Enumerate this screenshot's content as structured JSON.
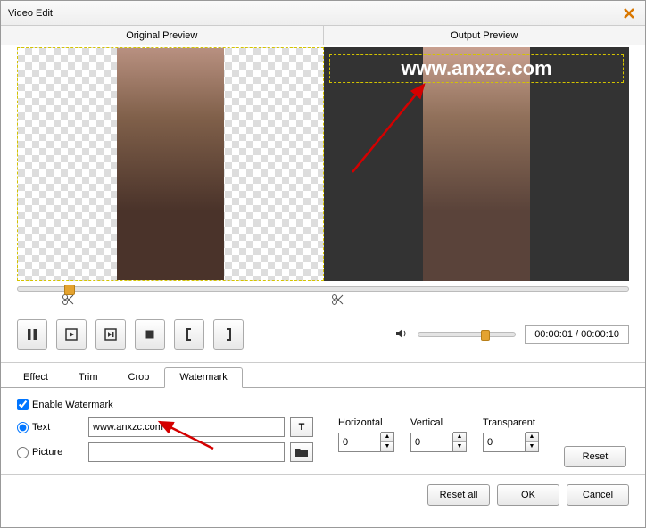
{
  "window": {
    "title": "Video Edit"
  },
  "previews": {
    "original_label": "Original Preview",
    "output_label": "Output Preview",
    "watermark_text": "www.anxzc.com"
  },
  "playback": {
    "time_current": "00:00:01",
    "time_total": "00:00:10",
    "time_display": "00:00:01 / 00:00:10"
  },
  "tabs": {
    "effect": "Effect",
    "trim": "Trim",
    "crop": "Crop",
    "watermark": "Watermark",
    "active": "watermark"
  },
  "watermark": {
    "enable_label": "Enable Watermark",
    "enable_checked": true,
    "text_label": "Text",
    "picture_label": "Picture",
    "mode": "text",
    "text_value": "www.anxzc.com",
    "picture_value": ""
  },
  "position": {
    "horizontal_label": "Horizontal",
    "vertical_label": "Vertical",
    "transparent_label": "Transparent",
    "horizontal": "0",
    "vertical": "0",
    "transparent": "0"
  },
  "buttons": {
    "reset": "Reset",
    "reset_all": "Reset all",
    "ok": "OK",
    "cancel": "Cancel"
  }
}
